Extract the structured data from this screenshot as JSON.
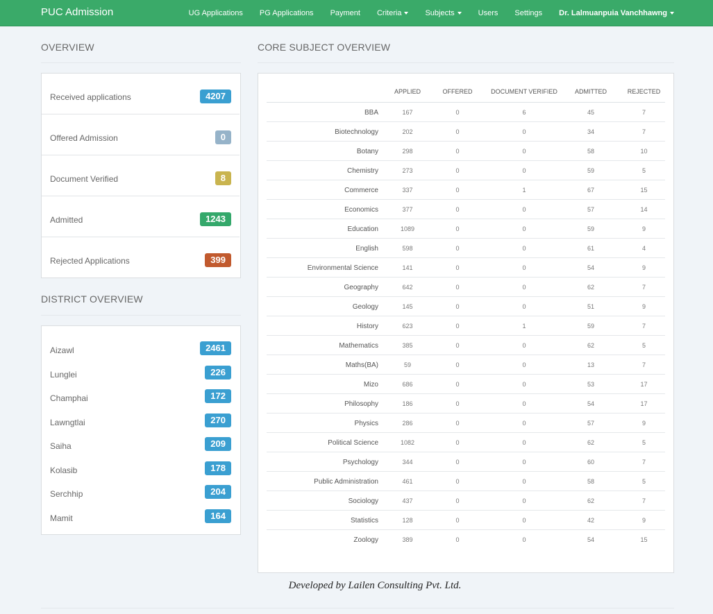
{
  "app": {
    "brand": "PUC Admission"
  },
  "nav": {
    "items": [
      {
        "label": "UG Applications",
        "dropdown": false
      },
      {
        "label": "PG Applications",
        "dropdown": false
      },
      {
        "label": "Payment",
        "dropdown": false
      },
      {
        "label": "Criteria",
        "dropdown": true
      },
      {
        "label": "Subjects",
        "dropdown": true
      },
      {
        "label": "Users",
        "dropdown": false
      },
      {
        "label": "Settings",
        "dropdown": false
      }
    ],
    "user": "Dr. Lalmuanpuia Vanchhawng"
  },
  "overview": {
    "title": "OVERVIEW",
    "items": [
      {
        "label": "Received applications",
        "value": "4207",
        "color": "#3a9fd1"
      },
      {
        "label": "Offered Admission",
        "value": "0",
        "color": "#96b3c9"
      },
      {
        "label": "Document Verified",
        "value": "8",
        "color": "#c9b44f"
      },
      {
        "label": "Admitted",
        "value": "1243",
        "color": "#34a86b"
      },
      {
        "label": "Rejected Applications",
        "value": "399",
        "color": "#c15a2e"
      }
    ]
  },
  "district": {
    "title": "DISTRICT OVERVIEW",
    "items": [
      {
        "label": "Aizawl",
        "value": "2461"
      },
      {
        "label": "Lunglei",
        "value": "226"
      },
      {
        "label": "Champhai",
        "value": "172"
      },
      {
        "label": "Lawngtlai",
        "value": "270"
      },
      {
        "label": "Saiha",
        "value": "209"
      },
      {
        "label": "Kolasib",
        "value": "178"
      },
      {
        "label": "Serchhip",
        "value": "204"
      },
      {
        "label": "Mamit",
        "value": "164"
      }
    ]
  },
  "core": {
    "title": "CORE SUBJECT OVERVIEW",
    "headers": [
      "APPLIED",
      "OFFERED",
      "DOCUMENT VERIFIED",
      "ADMITTED",
      "REJECTED"
    ],
    "rows": [
      {
        "name": "BBA",
        "applied": "167",
        "offered": "0",
        "verified": "6",
        "admitted": "45",
        "rejected": "7"
      },
      {
        "name": "Biotechnology",
        "applied": "202",
        "offered": "0",
        "verified": "0",
        "admitted": "34",
        "rejected": "7"
      },
      {
        "name": "Botany",
        "applied": "298",
        "offered": "0",
        "verified": "0",
        "admitted": "58",
        "rejected": "10"
      },
      {
        "name": "Chemistry",
        "applied": "273",
        "offered": "0",
        "verified": "0",
        "admitted": "59",
        "rejected": "5"
      },
      {
        "name": "Commerce",
        "applied": "337",
        "offered": "0",
        "verified": "1",
        "admitted": "67",
        "rejected": "15"
      },
      {
        "name": "Economics",
        "applied": "377",
        "offered": "0",
        "verified": "0",
        "admitted": "57",
        "rejected": "14"
      },
      {
        "name": "Education",
        "applied": "1089",
        "offered": "0",
        "verified": "0",
        "admitted": "59",
        "rejected": "9"
      },
      {
        "name": "English",
        "applied": "598",
        "offered": "0",
        "verified": "0",
        "admitted": "61",
        "rejected": "4"
      },
      {
        "name": "Environmental Science",
        "applied": "141",
        "offered": "0",
        "verified": "0",
        "admitted": "54",
        "rejected": "9"
      },
      {
        "name": "Geography",
        "applied": "642",
        "offered": "0",
        "verified": "0",
        "admitted": "62",
        "rejected": "7"
      },
      {
        "name": "Geology",
        "applied": "145",
        "offered": "0",
        "verified": "0",
        "admitted": "51",
        "rejected": "9"
      },
      {
        "name": "History",
        "applied": "623",
        "offered": "0",
        "verified": "1",
        "admitted": "59",
        "rejected": "7"
      },
      {
        "name": "Mathematics",
        "applied": "385",
        "offered": "0",
        "verified": "0",
        "admitted": "62",
        "rejected": "5"
      },
      {
        "name": "Maths(BA)",
        "applied": "59",
        "offered": "0",
        "verified": "0",
        "admitted": "13",
        "rejected": "7"
      },
      {
        "name": "Mizo",
        "applied": "686",
        "offered": "0",
        "verified": "0",
        "admitted": "53",
        "rejected": "17"
      },
      {
        "name": "Philosophy",
        "applied": "186",
        "offered": "0",
        "verified": "0",
        "admitted": "54",
        "rejected": "17"
      },
      {
        "name": "Physics",
        "applied": "286",
        "offered": "0",
        "verified": "0",
        "admitted": "57",
        "rejected": "9"
      },
      {
        "name": "Political Science",
        "applied": "1082",
        "offered": "0",
        "verified": "0",
        "admitted": "62",
        "rejected": "5"
      },
      {
        "name": "Psychology",
        "applied": "344",
        "offered": "0",
        "verified": "0",
        "admitted": "60",
        "rejected": "7"
      },
      {
        "name": "Public Administration",
        "applied": "461",
        "offered": "0",
        "verified": "0",
        "admitted": "58",
        "rejected": "5"
      },
      {
        "name": "Sociology",
        "applied": "437",
        "offered": "0",
        "verified": "0",
        "admitted": "62",
        "rejected": "7"
      },
      {
        "name": "Statistics",
        "applied": "128",
        "offered": "0",
        "verified": "0",
        "admitted": "42",
        "rejected": "9"
      },
      {
        "name": "Zoology",
        "applied": "389",
        "offered": "0",
        "verified": "0",
        "admitted": "54",
        "rejected": "15"
      }
    ]
  },
  "footer": {
    "text": "Developed by Lailen Consulting Pvt. Ltd."
  }
}
